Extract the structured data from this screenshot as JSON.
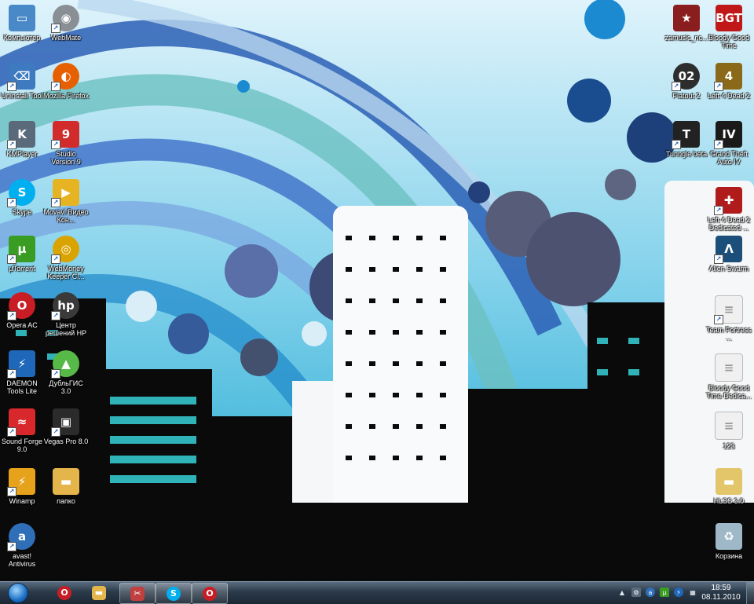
{
  "desktop_icons": {
    "left_col1": [
      {
        "label": "Компьютер",
        "icon": "computer-icon",
        "color": "#4a89c8"
      },
      {
        "label": "Uninstall Tool",
        "icon": "uninstall-icon",
        "color": "#3d7ac0"
      },
      {
        "label": "KMPlayer",
        "icon": "kmplayer-icon",
        "color": "#5b6a7a"
      },
      {
        "label": "Skype",
        "icon": "skype-icon",
        "color": "#00aff0"
      },
      {
        "label": "µTorrent",
        "icon": "utorrent-icon",
        "color": "#3a9d23"
      },
      {
        "label": "Opera AC",
        "icon": "opera-icon",
        "color": "#c81d25"
      },
      {
        "label": "DAEMON Tools Lite",
        "icon": "daemon-tools-icon",
        "color": "#1f67b8"
      },
      {
        "label": "Sound Forge 9.0",
        "icon": "sound-forge-icon",
        "color": "#d8282c"
      },
      {
        "label": "Winamp",
        "icon": "winamp-icon",
        "color": "#e7a21b"
      },
      {
        "label": "avast! Antivirus",
        "icon": "avast-icon",
        "color": "#2f6fb7"
      }
    ],
    "left_col2": [
      {
        "label": "WebMate",
        "icon": "webcam-icon",
        "color": "#8a8f96"
      },
      {
        "label": "Mozilla Firefox",
        "icon": "firefox-icon",
        "color": "#e66000"
      },
      {
        "label": "Studio Version 9",
        "icon": "studio-icon",
        "color": "#d22b2b"
      },
      {
        "label": "Movavi Видео Кон...",
        "icon": "movavi-icon",
        "color": "#e6b422"
      },
      {
        "label": "WebMoney Keeper Cl...",
        "icon": "webmoney-icon",
        "color": "#d9a400"
      },
      {
        "label": "Центр решений HP",
        "icon": "hp-icon",
        "color": "#3a3a3a"
      },
      {
        "label": "ДубльГИС 3.0",
        "icon": "dublgis-icon",
        "color": "#57b947"
      },
      {
        "label": "Vegas Pro 8.0",
        "icon": "vegas-icon",
        "color": "#2b2b2b"
      },
      {
        "label": "папко",
        "icon": "folder-icon",
        "color": "#e3b54a"
      }
    ],
    "right_col1": [
      {
        "label": "zamusic_nc...",
        "icon": "game-red-icon",
        "color": "#8a1e1e"
      },
      {
        "label": "Flatout 2",
        "icon": "flatout-icon",
        "color": "#2d2d2d"
      },
      {
        "label": "Tunngle beta",
        "icon": "tunngle-icon",
        "color": "#222222"
      }
    ],
    "right_col2": [
      {
        "label": "Bloody Good Time",
        "icon": "bgt-icon",
        "color": "#c01818"
      },
      {
        "label": "Left 4 Dead 2",
        "icon": "l4d2-icon",
        "color": "#8a6a1a"
      },
      {
        "label": "Grand Theft Auto IV",
        "icon": "gta-icon",
        "color": "#1a1a1a"
      },
      {
        "label": "Left 4 Dead 2 Dedicated ...",
        "icon": "l4d2-dedicated-icon",
        "color": "#b01c1c"
      },
      {
        "label": "Alien Swarm",
        "icon": "alien-swarm-icon",
        "color": "#1b4f7a"
      },
      {
        "label": "Team Fortress ...",
        "icon": "document-icon",
        "color": "#f0f0f0"
      },
      {
        "label": "Bloody Good Time Dedica...",
        "icon": "document-icon",
        "color": "#f0f0f0"
      },
      {
        "label": "123",
        "icon": "document-icon",
        "color": "#f0f0f0"
      },
      {
        "label": "HLSS 3.0",
        "icon": "folder-icon",
        "color": "#e3c56a"
      },
      {
        "label": "Корзина",
        "icon": "recycle-bin-icon",
        "color": "#9fb8c8"
      }
    ]
  },
  "taskbar": {
    "pinned": [
      {
        "icon": "opera-icon",
        "color": "#c81d25",
        "open": false
      },
      {
        "icon": "explorer-folder-icon",
        "color": "#e3b54a",
        "open": false
      },
      {
        "icon": "tool-icon",
        "color": "#c04040",
        "open": true
      },
      {
        "icon": "skype-icon",
        "color": "#00aff0",
        "open": true
      },
      {
        "icon": "opera-icon",
        "color": "#c81d25",
        "open": true
      }
    ],
    "clock_time": "18:59",
    "clock_date": "08.11.2010"
  }
}
